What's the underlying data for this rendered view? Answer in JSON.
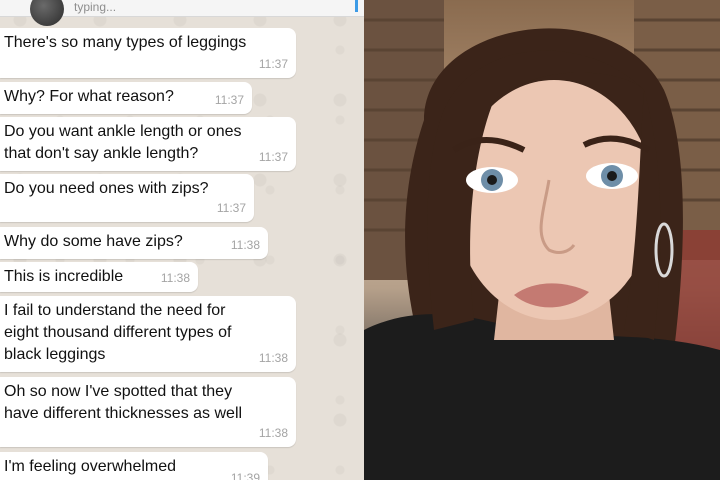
{
  "header": {
    "status": "typing..."
  },
  "messages": [
    {
      "text": "There's so many types of leggings",
      "time": "11:37"
    },
    {
      "text": "Why? For what reason?",
      "time": "11:37"
    },
    {
      "text": "Do you want ankle length or ones\nthat don't say ankle length?",
      "time": "11:37"
    },
    {
      "text": "Do you need ones with zips?",
      "time": "11:37"
    },
    {
      "text": "Why do some have zips?",
      "time": "11:38"
    },
    {
      "text": "This is incredible",
      "time": "11:38"
    },
    {
      "text": "I fail to understand the need for\neight thousand different types of\nblack leggings",
      "time": "11:38"
    },
    {
      "text": "Oh so now I've spotted that they\nhave different thicknesses as well",
      "time": "11:38"
    },
    {
      "text": "I'm feeling overwhelmed",
      "time": "11:39"
    }
  ],
  "colors": {
    "chat_background": "#e6e0d8",
    "bubble": "#ffffff",
    "timestamp": "#a4a4a4"
  }
}
